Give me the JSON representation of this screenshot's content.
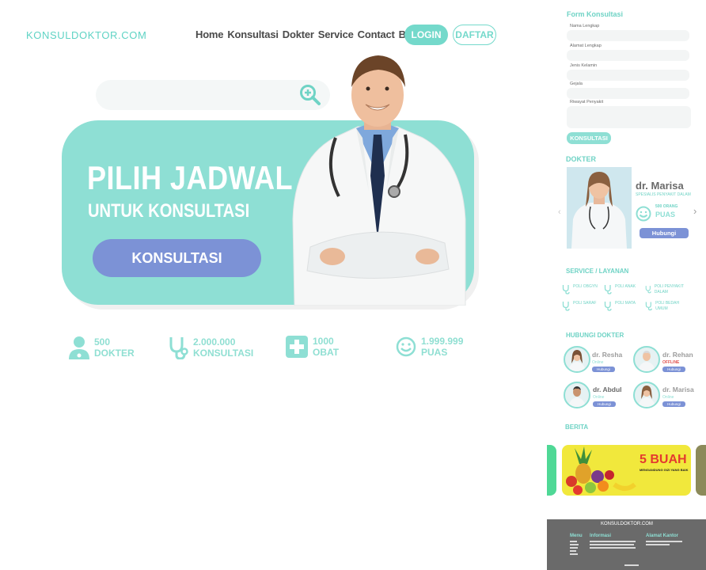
{
  "header": {
    "logo": "KONSULDOKTOR.COM",
    "nav": [
      "Home",
      "Konsultasi",
      "Dokter",
      "Service",
      "Contact",
      "Berita"
    ],
    "login": "LOGIN",
    "daftar": "DAFTAR"
  },
  "search": {
    "placeholder": ""
  },
  "hero": {
    "title": "PILIH JADWAL",
    "subtitle": "UNTUK KONSULTASI",
    "button": "KONSULTASI"
  },
  "stats": [
    {
      "num": "500",
      "label": "DOKTER",
      "icon": "doctor-icon"
    },
    {
      "num": "2.000.000",
      "label": "KONSULTASI",
      "icon": "stethoscope-icon"
    },
    {
      "num": "1000",
      "label": "OBAT",
      "icon": "medical-cross-icon"
    },
    {
      "num": "1.999.999",
      "label": "PUAS",
      "icon": "smiley-icon"
    }
  ],
  "sidebar": {
    "form": {
      "title": "Form Konsultasi",
      "fields": [
        "Nama Lengkap",
        "Alamat Lengkap",
        "Jenis Kelamin",
        "Gejala",
        "Riwayat Penyakit"
      ],
      "submit": "KONSULTASI"
    },
    "dokter": {
      "title": "DOKTER",
      "name": "dr. Marisa",
      "specialty": "SPESIALIS PENYAKIT DALAM",
      "count": "500 ORANG",
      "puas": "PUAS",
      "button": "Hubungi"
    },
    "service": {
      "title": "SERVICE / LAYANAN",
      "items": [
        "POLI OBGYN",
        "POLI ANAK",
        "POLI PENYAKIT DALAM",
        "POLI SARAF",
        "POLI MATA",
        "POLI BEDAH UMUM"
      ]
    },
    "hubungi": {
      "title": "HUBUNGI DOKTER",
      "doctors": [
        {
          "name": "dr. Resha",
          "status": "Online",
          "button": "Hubungi"
        },
        {
          "name": "dr. Rehan",
          "status": "OFFLINE",
          "button": "Hubungi"
        },
        {
          "name": "dr. Abdul",
          "status": "Online",
          "button": "Hubungi"
        },
        {
          "name": "dr. Marisa",
          "status": "Online",
          "button": "Hubungi"
        }
      ]
    },
    "berita": {
      "title": "BERITA",
      "headline": "5 BUAH",
      "tagline": "MENGANDUNG GIZI YANG BAIK"
    }
  },
  "footer": {
    "logo": "KONSULDOKTOR.COM",
    "col1": "Menu",
    "col2": "Informasi",
    "col3": "Alamat Kantor"
  },
  "colors": {
    "accent": "#8edfd4",
    "button": "#7c92d6",
    "logo": "#5fd3c4",
    "footer": "#6a6a6a"
  }
}
